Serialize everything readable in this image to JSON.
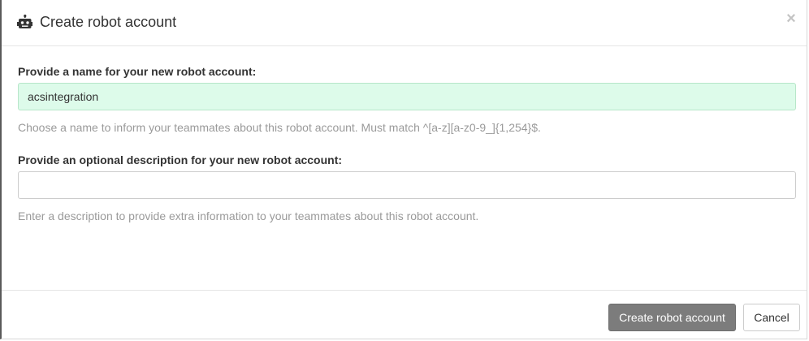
{
  "header": {
    "icon": "robot-icon",
    "title": "Create robot account",
    "close_glyph": "×"
  },
  "name_field": {
    "label": "Provide a name for your new robot account:",
    "value": "acsintegration",
    "help": "Choose a name to inform your teammates about this robot account. Must match ^[a-z][a-z0-9_]{1,254}$."
  },
  "description_field": {
    "label": "Provide an optional description for your new robot account:",
    "value": "",
    "help": "Enter a description to provide extra information to your teammates about this robot account."
  },
  "footer": {
    "create_label": "Create robot account",
    "cancel_label": "Cancel"
  },
  "colors": {
    "valid_input_bg": "#ddfbea",
    "primary_button_bg": "#7c7c7c",
    "help_text": "#9a9a9a"
  }
}
